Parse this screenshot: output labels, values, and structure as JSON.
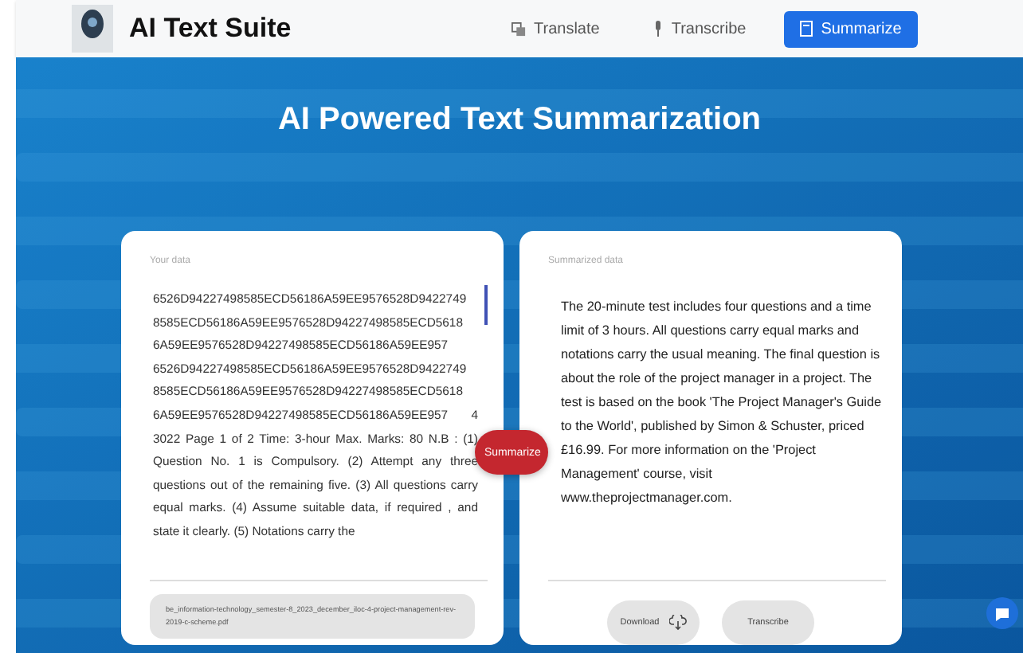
{
  "app": {
    "title": "AI Text Suite"
  },
  "nav": [
    {
      "label": "Translate",
      "selected": false
    },
    {
      "label": "Transcribe",
      "selected": false
    },
    {
      "label": "Summarize",
      "selected": true
    }
  ],
  "hero": {
    "title": "AI Powered Text Summarization"
  },
  "input_panel": {
    "label": "Your data",
    "text": "6526D94227498585ECD56186A59EE9576528D9422749 8585ECD56186A59EE9576528D94227498585ECD5618 6A59EE9576528D94227498585ECD56186A59EE957 6526D94227498585ECD56186A59EE9576528D9422749 8585ECD56186A59EE9576528D94227498585ECD5618 6A59EE9576528D94227498585ECD56186A59EE957 4 3022 Page 1 of 2 Time: 3-hour Max. Marks: 80 N.B : (1) Question No. 1 is Compulsory. (2) Attempt any three questions out of the remaining five. (3) All questions carry equal marks. (4) Assume suitable data, if required , and state it clearly. (5) Notations carry the",
    "file": "be_information-technology_semester-8_2023_december_iloc-4-project-management-rev-2019-c-scheme.pdf"
  },
  "summarize_button": "Summarize",
  "output_panel": {
    "label": "Summarized data",
    "text": "The 20-minute test includes four questions and a time limit of 3 hours. All questions carry equal marks and notations carry the usual meaning. The final question is about the role of the project manager in a project. The test is based on the book 'The Project Manager's Guide to the World', published by Simon & Schuster, priced £16.99. For more information on the 'Project Management' course, visit www.theprojectmanager.com.",
    "buttons": [
      {
        "label": "Download",
        "kind": "download"
      },
      {
        "label": "Transcribe",
        "kind": "plain"
      }
    ]
  }
}
